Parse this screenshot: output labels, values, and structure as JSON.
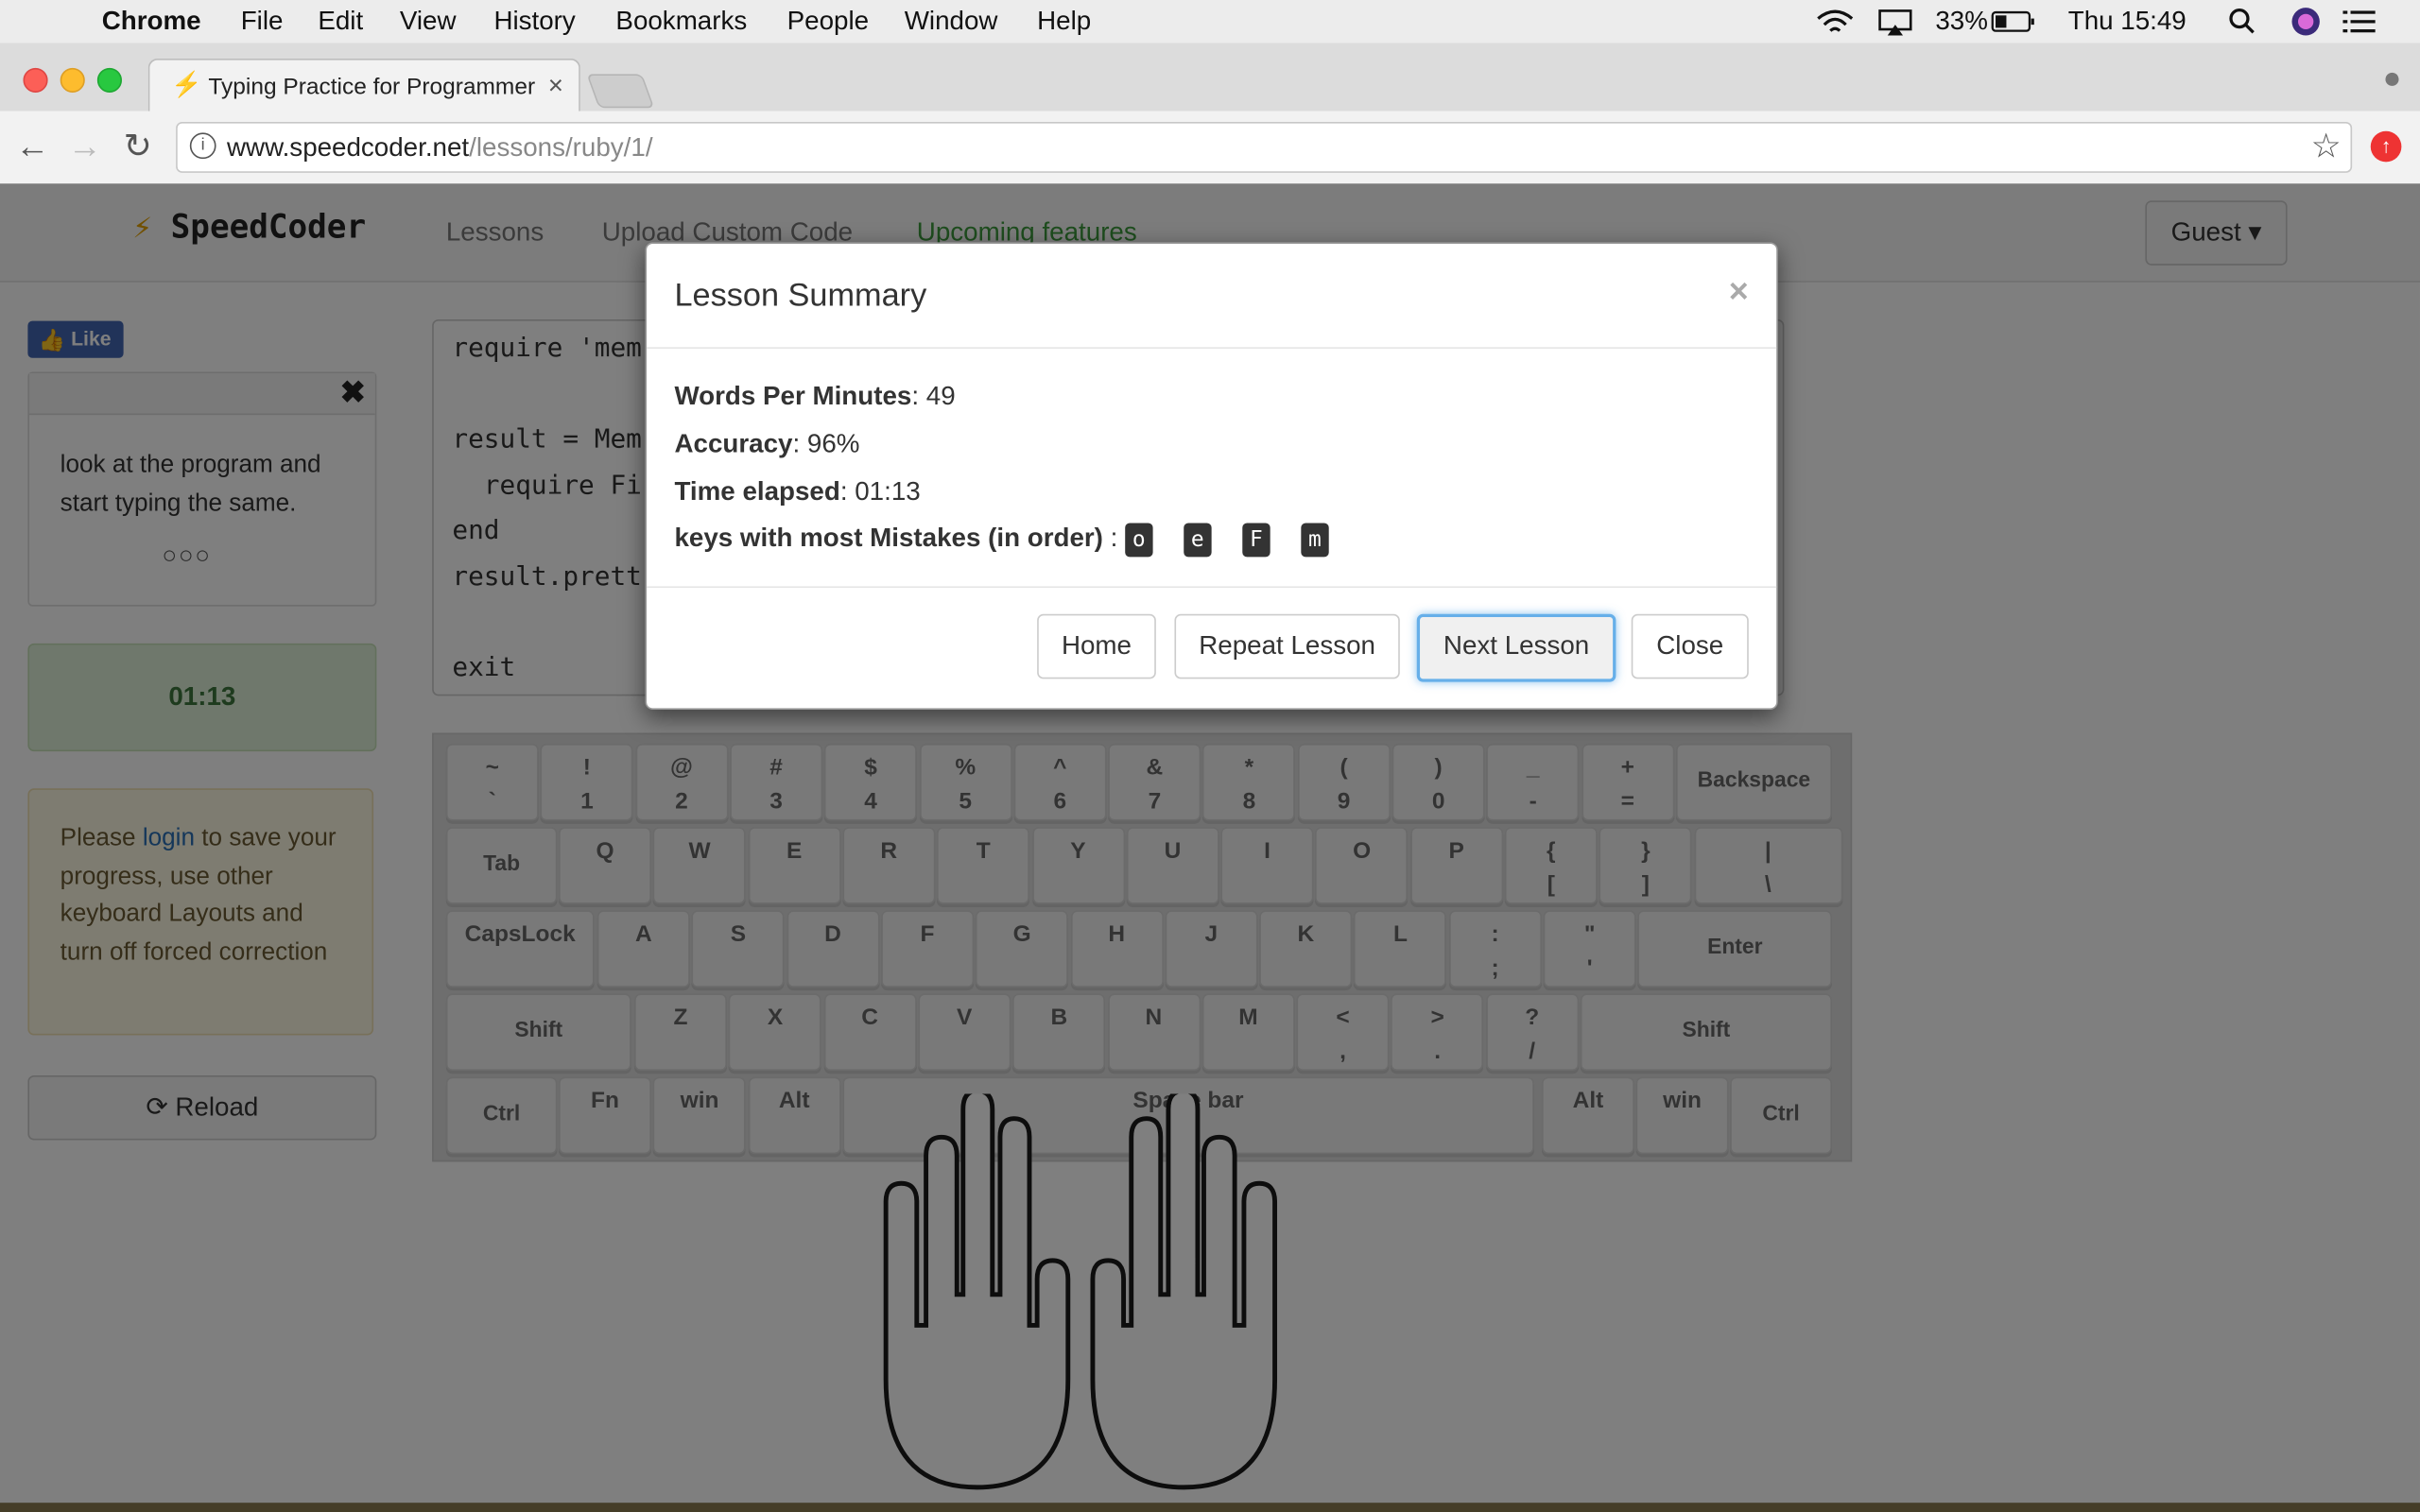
{
  "menubar": {
    "app": "Chrome",
    "items": [
      "File",
      "Edit",
      "View",
      "History",
      "Bookmarks",
      "People",
      "Window",
      "Help"
    ],
    "battery": "33%",
    "clock": "Thu 15:49"
  },
  "browser": {
    "tab_title": "Typing Practice for Programmers",
    "url_host": "www.speedcoder.net",
    "url_path": "/lessons/ruby/1/"
  },
  "site": {
    "brand": "SpeedCoder",
    "nav": [
      "Lessons",
      "Upload Custom Code",
      "Upcoming features"
    ],
    "account": "Guest",
    "like": "Like",
    "tip_text": "look at the program and start typing the same.",
    "timer": "01:13",
    "login_pre": "Please ",
    "login_link": "login",
    "login_post": " to save your progress, use other keyboard Layouts and turn off forced correction",
    "reload": "Reload",
    "code_lines": [
      "require 'mem",
      "",
      "result = Mem",
      "  require Fi",
      "end",
      "result.prett",
      "",
      "exit"
    ]
  },
  "keyboard": {
    "row1": [
      [
        "~",
        "`"
      ],
      [
        "!",
        "1"
      ],
      [
        "@",
        "2"
      ],
      [
        "#",
        "3"
      ],
      [
        "$",
        "4"
      ],
      [
        "%",
        "5"
      ],
      [
        "^",
        "6"
      ],
      [
        "&",
        "7"
      ],
      [
        "*",
        "8"
      ],
      [
        "(",
        "9"
      ],
      [
        ")",
        "0"
      ],
      [
        "_",
        "-"
      ],
      [
        "+",
        "="
      ]
    ],
    "row2": [
      "Q",
      "W",
      "E",
      "R",
      "T",
      "Y",
      "U",
      "I",
      "O",
      "P"
    ],
    "row2_end": [
      [
        "{",
        "["
      ],
      [
        "}",
        "]"
      ],
      [
        "|",
        "\\"
      ]
    ],
    "row3": [
      "A",
      "S",
      "D",
      "F",
      "G",
      "H",
      "J",
      "K",
      "L"
    ],
    "row3_end": [
      [
        ":",
        ";"
      ],
      [
        "\"",
        "'"
      ]
    ],
    "row4": [
      "Z",
      "X",
      "C",
      "V",
      "B",
      "N",
      "M"
    ],
    "row4_end": [
      [
        "<",
        ","
      ],
      [
        ">",
        "."
      ],
      [
        "?",
        "/"
      ]
    ],
    "labels": {
      "backspace": "Backspace",
      "tab": "Tab",
      "capslock": "CapsLock",
      "enter": "Enter",
      "shift": "Shift",
      "ctrl": "Ctrl",
      "fn": "Fn",
      "win": "win",
      "alt": "Alt",
      "space": "Space bar"
    }
  },
  "modal": {
    "title": "Lesson Summary",
    "wpm_label": "Words Per Minutes",
    "wpm_value": ": 49",
    "accuracy_label": "Accuracy",
    "accuracy_value": ": 96%",
    "time_label": "Time elapsed",
    "time_value": ": 01:13",
    "mistakes_label": "keys with most Mistakes (in order)",
    "mistakes_sep": " : ",
    "mistake_keys": [
      "o",
      "e",
      "F",
      "m"
    ],
    "buttons": {
      "home": "Home",
      "repeat": "Repeat Lesson",
      "next": "Next Lesson",
      "close": "Close"
    }
  }
}
